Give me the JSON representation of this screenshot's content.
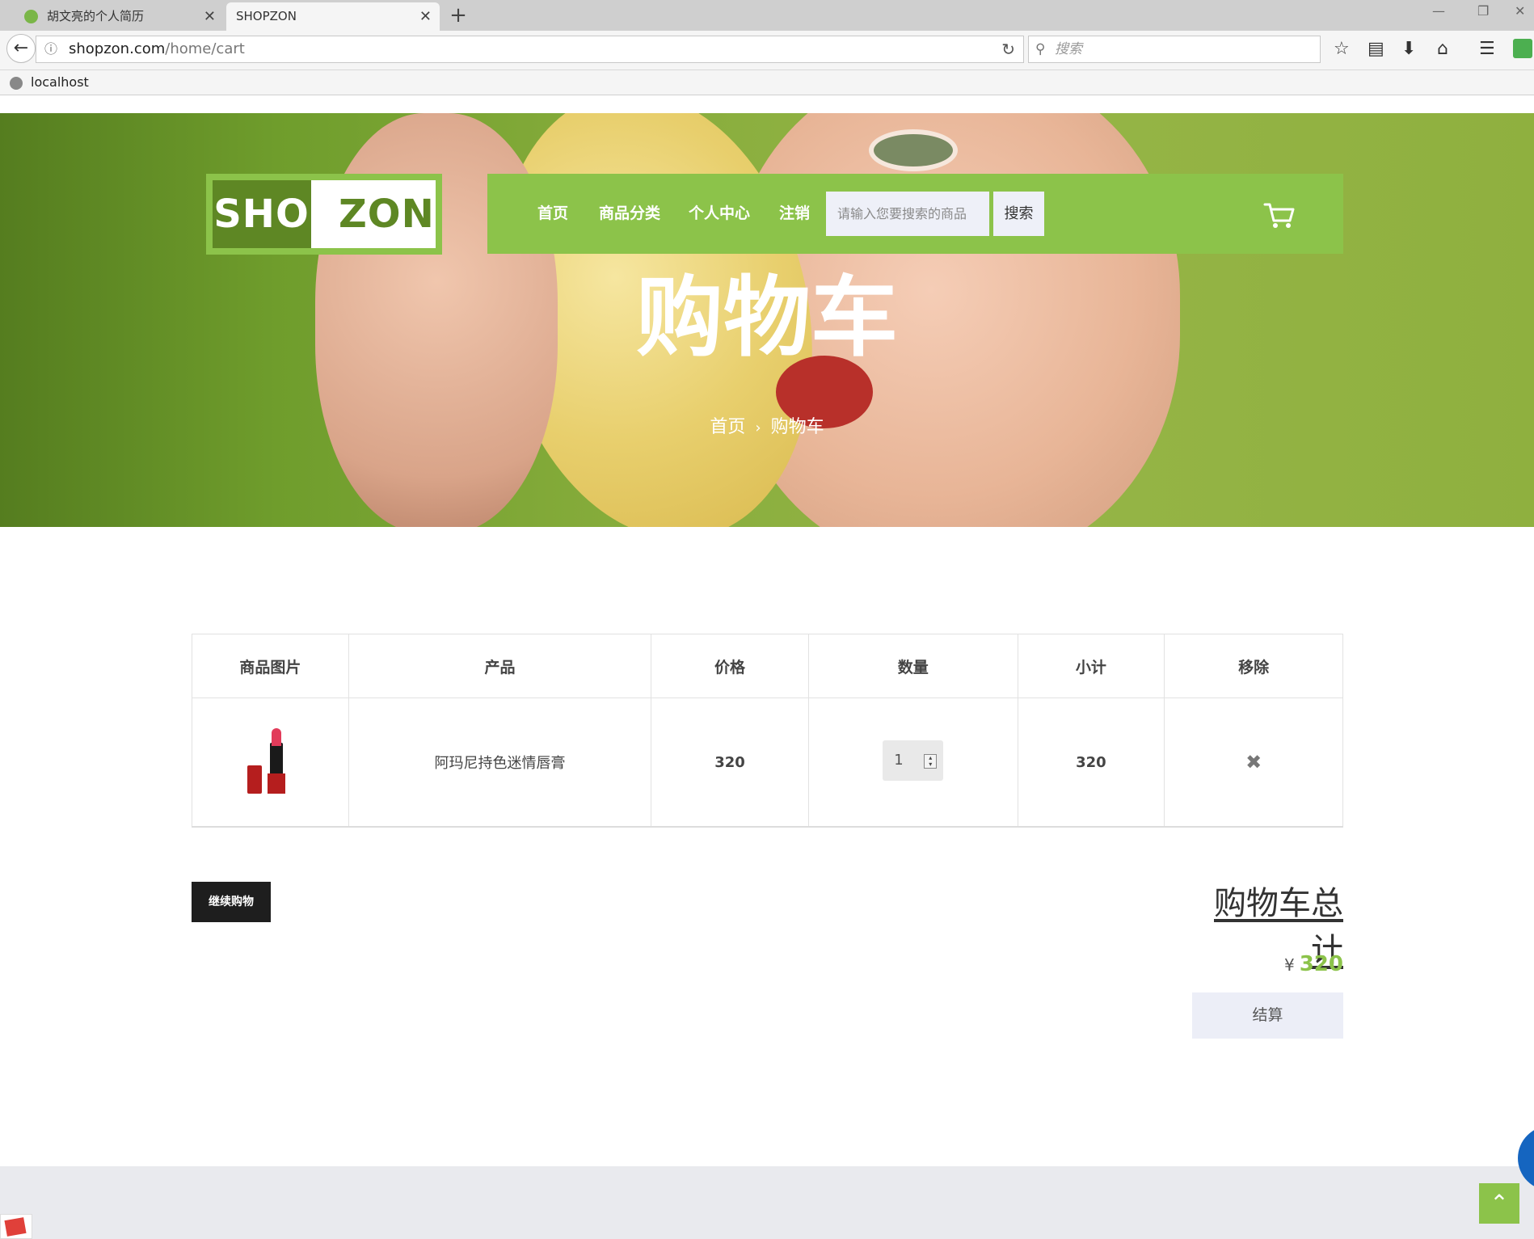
{
  "browser": {
    "tabs": [
      {
        "title": "胡文亮的个人简历",
        "active": false
      },
      {
        "title": "SHOPZON",
        "active": true
      }
    ],
    "new_tab": "+",
    "address": {
      "host": "shopzon.com",
      "path": "/home/cart"
    },
    "search_placeholder": "搜索",
    "bookmark": "localhost"
  },
  "header": {
    "logo_part1": "SHOP",
    "logo_part2": "ZON",
    "nav": [
      "首页",
      "商品分类",
      "个人中心",
      "注销"
    ],
    "search_placeholder": "请输入您要搜索的商品",
    "search_button": "搜索"
  },
  "hero": {
    "title": "购物车",
    "breadcrumb": {
      "home": "首页",
      "separator": "›",
      "current": "购物车"
    }
  },
  "cart": {
    "columns": [
      "商品图片",
      "产品",
      "价格",
      "数量",
      "小计",
      "移除"
    ],
    "rows": [
      {
        "product": "阿玛尼持色迷情唇膏",
        "price": "320",
        "quantity": "1",
        "subtotal": "320",
        "remove": "✖"
      }
    ]
  },
  "actions": {
    "continue_shopping": "继续购物"
  },
  "summary": {
    "title": "购物车总计",
    "currency": "¥",
    "total": "320",
    "checkout": "结算"
  },
  "colors": {
    "accent": "#8cc34a",
    "dark_button": "#1e1e1e",
    "checkout_bg": "#eceef7"
  },
  "icons": [
    "back-icon",
    "info-icon",
    "reload-icon",
    "search-icon",
    "star-icon",
    "reader-icon",
    "download-icon",
    "home-icon",
    "menu-icon",
    "cart-icon",
    "remove-icon",
    "arrow-up-icon"
  ]
}
